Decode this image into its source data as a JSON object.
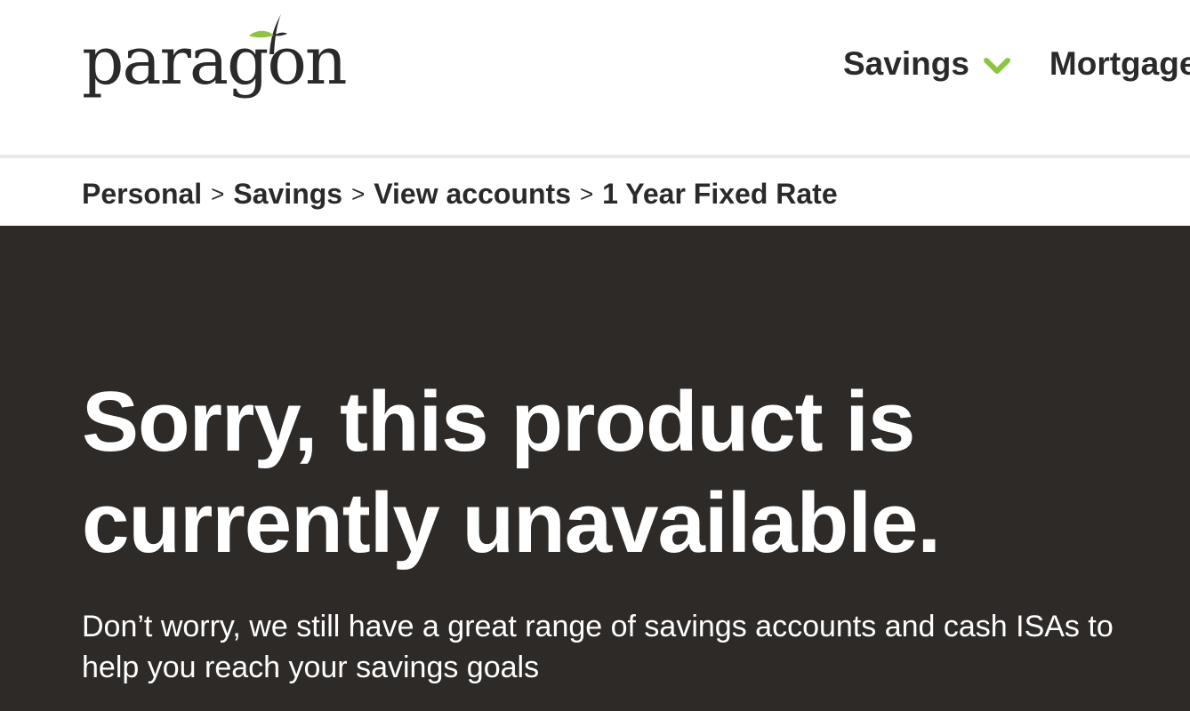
{
  "header": {
    "logo_text": "paragon",
    "nav": [
      {
        "label": "Savings",
        "has_dropdown": true
      },
      {
        "label": "Mortgage"
      }
    ]
  },
  "breadcrumb": {
    "items": [
      "Personal",
      "Savings",
      "View accounts"
    ],
    "separator": ">",
    "current": "1 Year Fixed Rate"
  },
  "hero": {
    "title": "Sorry, this product is currently unavailable.",
    "body": "Don’t worry, we still have a great range of savings accounts and cash ISAs to help you reach your savings goals"
  },
  "colors": {
    "brand_dark": "#2c2a29",
    "hero_background": "#2e2a27",
    "accent_green": "#8cc63f",
    "divider": "#e9e9e9"
  },
  "icons": [
    "paragon-leaf-icon",
    "chevron-down-icon"
  ]
}
